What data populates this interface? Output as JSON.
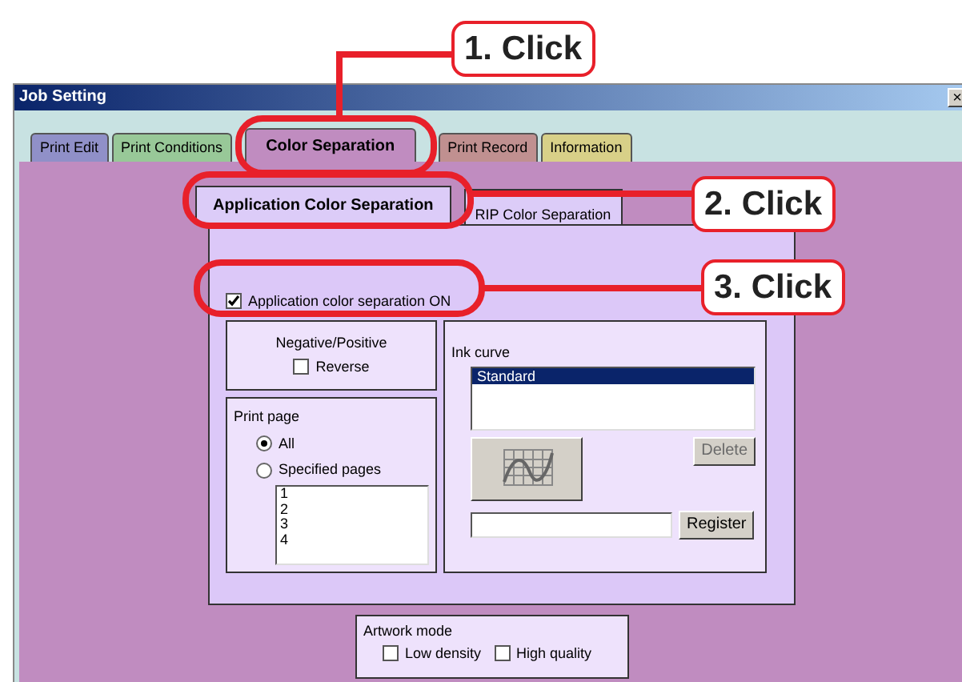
{
  "window": {
    "title": "Job Setting",
    "close": "×"
  },
  "tabs": [
    {
      "label": "Print Edit",
      "selected": false,
      "color": "#9090c8"
    },
    {
      "label": "Print Conditions",
      "selected": false,
      "color": "#98c898"
    },
    {
      "label": "Color Separation",
      "selected": true,
      "color": "#c08cc0"
    },
    {
      "label": "Print Record",
      "selected": false,
      "color": "#c09090"
    },
    {
      "label": "Information",
      "selected": false,
      "color": "#d8d088"
    }
  ],
  "subtabs": [
    {
      "label": "Application Color Separation",
      "selected": true
    },
    {
      "label": "RIP Color Separation",
      "selected": false
    }
  ],
  "app_separation": {
    "label": "Application color separation ON",
    "checked": true
  },
  "negative_positive": {
    "title": "Negative/Positive",
    "reverse": {
      "label": "Reverse",
      "checked": false
    }
  },
  "print_page": {
    "title": "Print page",
    "options": [
      {
        "label": "All",
        "selected": true
      },
      {
        "label": "Specified pages",
        "selected": false
      }
    ],
    "pages": [
      "1",
      "2",
      "3",
      "4"
    ]
  },
  "ink_curve": {
    "title": "Ink curve",
    "items": [
      {
        "label": "Standard",
        "selected": true
      }
    ],
    "delete": {
      "label": "Delete",
      "disabled": true
    },
    "register": "Register"
  },
  "artwork_mode": {
    "title": "Artwork mode",
    "options": [
      {
        "label": "Low density",
        "checked": false
      },
      {
        "label": "High quality",
        "checked": false
      }
    ]
  },
  "callouts": [
    {
      "label": "1. Click"
    },
    {
      "label": "2. Click"
    },
    {
      "label": "3. Click"
    }
  ]
}
